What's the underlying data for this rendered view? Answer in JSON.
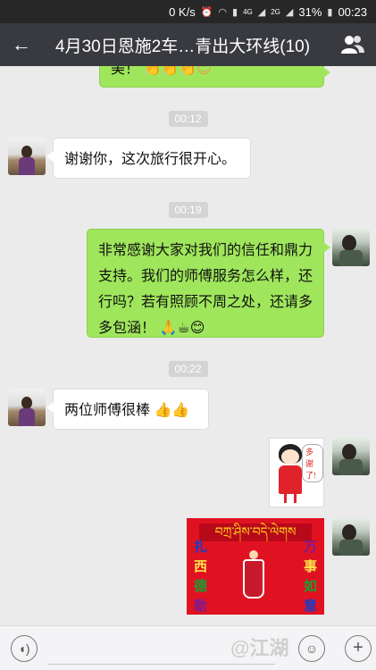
{
  "status_bar": {
    "net_speed": "0 K/s",
    "signal_4g": "4G",
    "signal_2g": "2G",
    "battery": "31%",
    "time": "00:23"
  },
  "header": {
    "title": "4月30日恩施2车…青出大环线(10)",
    "back_icon": "arrow-left-icon",
    "members_icon": "people-icon"
  },
  "messages": {
    "partial_text": "美！",
    "time_1": "00:12",
    "msg_1": "谢谢你，这次旅行很开心。",
    "time_2": "00:19",
    "msg_2": "非常感谢大家对我们的信任和鼎力支持。我们的师傅服务怎么样，还行吗？若有照顾不周之处，还请多多包涵！",
    "time_3": "00:22",
    "msg_3": "两位师傅很棒",
    "sticker_text": "多谢了!",
    "card_banner": "བཀྲ་ཤིས་བདེ་ལེགས",
    "card_left": [
      "扎",
      "西",
      "德",
      "勒"
    ],
    "card_right": [
      "万",
      "事",
      "如",
      "意"
    ]
  },
  "input_bar": {
    "watermark": "@江湖"
  }
}
